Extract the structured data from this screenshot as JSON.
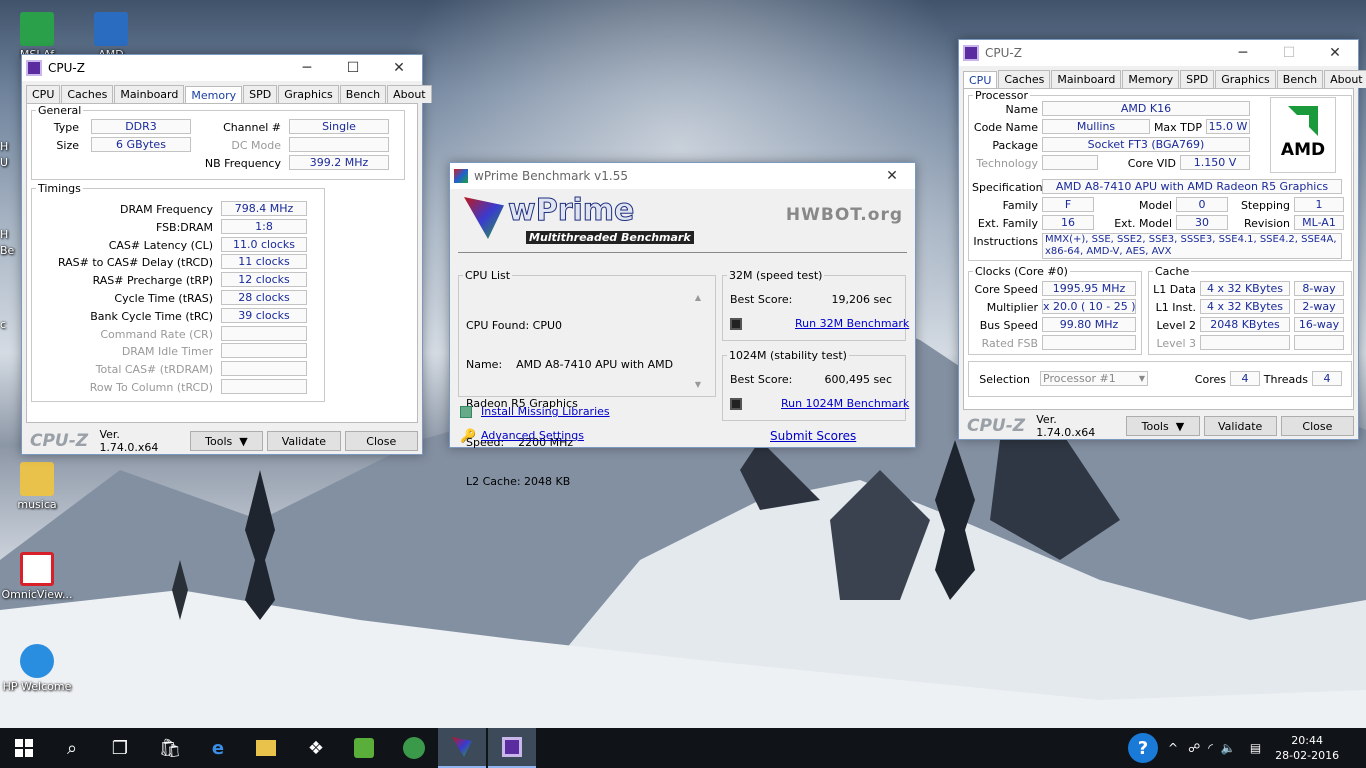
{
  "desktop": {
    "icons": [
      {
        "label": "MSI Af",
        "color": "#2aa04a"
      },
      {
        "label": "AMD",
        "color": "#2a6cc0"
      },
      {
        "label": "musica",
        "color": "#e8c24a"
      },
      {
        "label": "OmnicView...",
        "color": "#d8202a"
      },
      {
        "label": "HP Welcome",
        "color": "#2a8ee0"
      }
    ],
    "edge_fragments": [
      "H",
      "U",
      "H",
      "Be",
      "c"
    ]
  },
  "cpuz_mem": {
    "title": "CPU-Z",
    "tabs": [
      "CPU",
      "Caches",
      "Mainboard",
      "Memory",
      "SPD",
      "Graphics",
      "Bench",
      "About"
    ],
    "active_tab": "Memory",
    "general": {
      "legend": "General",
      "type_label": "Type",
      "type": "DDR3",
      "size_label": "Size",
      "size": "6 GBytes",
      "channel_label": "Channel #",
      "channel": "Single",
      "dc_label": "DC Mode",
      "dc": "",
      "nb_label": "NB Frequency",
      "nb": "399.2 MHz"
    },
    "timings": {
      "legend": "Timings",
      "rows": [
        {
          "label": "DRAM Frequency",
          "value": "798.4 MHz",
          "dim": false
        },
        {
          "label": "FSB:DRAM",
          "value": "1:8",
          "dim": false
        },
        {
          "label": "CAS# Latency (CL)",
          "value": "11.0 clocks",
          "dim": false
        },
        {
          "label": "RAS# to CAS# Delay (tRCD)",
          "value": "11 clocks",
          "dim": false
        },
        {
          "label": "RAS# Precharge (tRP)",
          "value": "12 clocks",
          "dim": false
        },
        {
          "label": "Cycle Time (tRAS)",
          "value": "28 clocks",
          "dim": false
        },
        {
          "label": "Bank Cycle Time (tRC)",
          "value": "39 clocks",
          "dim": false
        },
        {
          "label": "Command Rate (CR)",
          "value": "",
          "dim": true
        },
        {
          "label": "DRAM Idle Timer",
          "value": "",
          "dim": true
        },
        {
          "label": "Total CAS# (tRDRAM)",
          "value": "",
          "dim": true
        },
        {
          "label": "Row To Column (tRCD)",
          "value": "",
          "dim": true
        }
      ]
    },
    "logo": "CPU-Z",
    "version": "Ver. 1.74.0.x64",
    "tools": "Tools",
    "validate": "Validate",
    "close": "Close"
  },
  "wprime": {
    "title": "wPrime Benchmark v1.55",
    "logo": "wPrime",
    "tagline": "Multithreaded Benchmark",
    "hwbot": "HWBOT.org",
    "cpu_list_legend": "CPU List",
    "cpu_info": [
      "CPU Found: CPU0",
      "Name:    AMD A8-7410 APU with AMD",
      "Radeon R5 Graphics",
      "Speed:    2200 MHz",
      "L2 Cache: 2048 KB"
    ],
    "t32_legend": "32M (speed test)",
    "best_label": "Best Score:",
    "t32_score": "19,206 sec",
    "t32_run": "Run 32M Benchmark",
    "t1024_legend": "1024M (stability test)",
    "t1024_score": "600,495 sec",
    "t1024_run": "Run 1024M Benchmark",
    "install": "Install Missing Libraries",
    "advanced": "Advanced Settings",
    "submit": "Submit Scores"
  },
  "cpuz_cpu": {
    "title": "CPU-Z",
    "tabs": [
      "CPU",
      "Caches",
      "Mainboard",
      "Memory",
      "SPD",
      "Graphics",
      "Bench",
      "About"
    ],
    "active_tab": "CPU",
    "processor_legend": "Processor",
    "name_label": "Name",
    "name": "AMD K16",
    "code_label": "Code Name",
    "code": "Mullins",
    "tdp_label": "Max TDP",
    "tdp": "15.0 W",
    "pkg_label": "Package",
    "pkg": "Socket FT3 (BGA769)",
    "tech_label": "Technology",
    "tech": "",
    "vid_label": "Core VID",
    "vid": "1.150 V",
    "spec_label": "Specification",
    "spec": "AMD A8-7410 APU with AMD Radeon R5 Graphics",
    "family_label": "Family",
    "family": "F",
    "model_label": "Model",
    "model": "0",
    "stepping_label": "Stepping",
    "stepping": "1",
    "extfam_label": "Ext. Family",
    "extfam": "16",
    "extmod_label": "Ext. Model",
    "extmod": "30",
    "rev_label": "Revision",
    "rev": "ML-A1",
    "instr_label": "Instructions",
    "instr": "MMX(+), SSE, SSE2, SSE3, SSSE3, SSE4.1, SSE4.2, SSE4A, x86-64, AMD-V, AES, AVX",
    "amd_logo": "AMD",
    "clocks_legend": "Clocks (Core #0)",
    "speed_label": "Core Speed",
    "speed": "1995.95 MHz",
    "mult_label": "Multiplier",
    "mult": "x 20.0 ( 10 - 25 )",
    "bus_label": "Bus Speed",
    "bus": "99.80 MHz",
    "fsb_label": "Rated FSB",
    "fsb": "",
    "cache_legend": "Cache",
    "l1d_label": "L1 Data",
    "l1d": "4 x 32 KBytes",
    "l1d_way": "8-way",
    "l1i_label": "L1 Inst.",
    "l1i": "4 x 32 KBytes",
    "l1i_way": "2-way",
    "l2_label": "Level 2",
    "l2": "2048 KBytes",
    "l2_way": "16-way",
    "l3_label": "Level 3",
    "l3": "",
    "sel_label": "Selection",
    "sel": "Processor #1",
    "cores_label": "Cores",
    "cores": "4",
    "threads_label": "Threads",
    "threads": "4",
    "logo": "CPU-Z",
    "version": "Ver. 1.74.0.x64",
    "tools": "Tools",
    "validate": "Validate",
    "close": "Close"
  },
  "taskbar": {
    "time": "20:44",
    "date": "28-02-2016"
  }
}
